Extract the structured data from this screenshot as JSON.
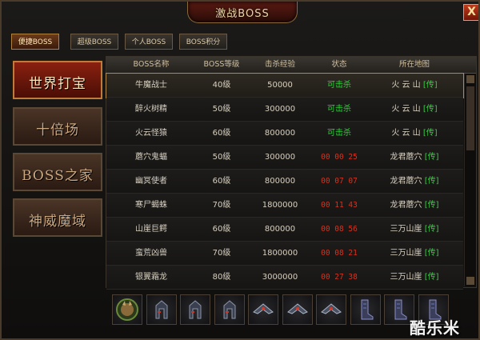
{
  "window": {
    "title": "激战BOSS",
    "close_label": "X"
  },
  "tabs": [
    {
      "label": "便捷BOSS",
      "active": true
    },
    {
      "label": "超级BOSS",
      "active": false
    },
    {
      "label": "个人BOSS",
      "active": false
    },
    {
      "label": "BOSS积分",
      "active": false
    }
  ],
  "sidebar": [
    {
      "label": "世界打宝",
      "active": true
    },
    {
      "label": "十倍场",
      "active": false
    },
    {
      "label": "BOSS之家",
      "active": false
    },
    {
      "label": "神威魔域",
      "active": false
    }
  ],
  "table": {
    "headers": [
      "BOSS名称",
      "BOSS等级",
      "击杀经验",
      "状态",
      "所在地图"
    ],
    "teleport_label": "[传]",
    "rows": [
      {
        "name": "牛魔战士",
        "level": "40级",
        "exp": "50000",
        "status": "可击杀",
        "status_type": "green",
        "map": "火 云 山"
      },
      {
        "name": "醉火树精",
        "level": "50级",
        "exp": "300000",
        "status": "可击杀",
        "status_type": "green",
        "map": "火 云 山"
      },
      {
        "name": "火云怪猿",
        "level": "60级",
        "exp": "800000",
        "status": "可击杀",
        "status_type": "green",
        "map": "火 云 山"
      },
      {
        "name": "蘑穴鬼蝠",
        "level": "50级",
        "exp": "300000",
        "status": "00 00 25",
        "status_type": "red",
        "map": "龙君蘑穴"
      },
      {
        "name": "幽冥使者",
        "level": "60级",
        "exp": "800000",
        "status": "00 07 07",
        "status_type": "red",
        "map": "龙君蘑穴"
      },
      {
        "name": "寒尸蝎蛛",
        "level": "70级",
        "exp": "1800000",
        "status": "00 11 43",
        "status_type": "red",
        "map": "龙君蘑穴"
      },
      {
        "name": "山崖巨鳄",
        "level": "60级",
        "exp": "800000",
        "status": "00 08 56",
        "status_type": "red",
        "map": "三万山崖"
      },
      {
        "name": "蛮荒凶兽",
        "level": "70级",
        "exp": "1800000",
        "status": "00 08 21",
        "status_type": "red",
        "map": "三万山崖"
      },
      {
        "name": "银翼霜龙",
        "level": "80级",
        "exp": "3000000",
        "status": "00 27 38",
        "status_type": "red",
        "map": "三万山崖"
      }
    ]
  },
  "drops": [
    {
      "icon": "boss-avatar-icon"
    },
    {
      "icon": "armor-helmet-icon"
    },
    {
      "icon": "armor-helmet-icon"
    },
    {
      "icon": "armor-helmet-icon"
    },
    {
      "icon": "shoulder-armor-icon"
    },
    {
      "icon": "shoulder-armor-icon"
    },
    {
      "icon": "shoulder-armor-icon"
    },
    {
      "icon": "boots-icon"
    },
    {
      "icon": "boots-icon"
    },
    {
      "icon": "boots-icon"
    }
  ],
  "watermark": "酷乐米",
  "colors": {
    "available": "#2fd23a",
    "countdown": "#d8321e",
    "accent": "#b08a4a"
  }
}
